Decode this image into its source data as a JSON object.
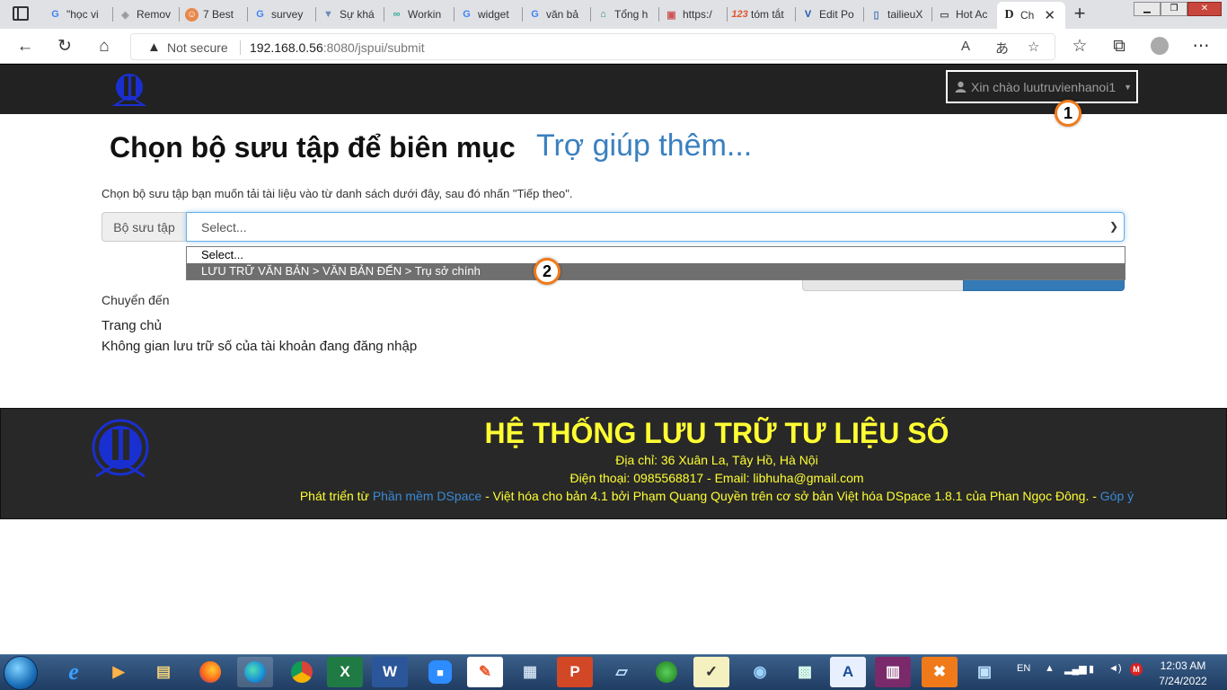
{
  "browser": {
    "tabs": [
      {
        "label": "\"học vi",
        "icon": "google-icon"
      },
      {
        "label": "Remov",
        "icon": "remove-icon"
      },
      {
        "label": "7 Best",
        "icon": "app-icon"
      },
      {
        "label": "survey",
        "icon": "google-icon"
      },
      {
        "label": "Sự khá",
        "icon": "web-icon"
      },
      {
        "label": "Workin",
        "icon": "web-icon"
      },
      {
        "label": "widget",
        "icon": "google-icon"
      },
      {
        "label": "văn bả",
        "icon": "google-icon"
      },
      {
        "label": "Tổng h",
        "icon": "web-icon"
      },
      {
        "label": "https:/",
        "icon": "web-icon"
      },
      {
        "label": "tóm tắt",
        "icon": "123doc-icon"
      },
      {
        "label": "Edit Po",
        "icon": "v-icon"
      },
      {
        "label": "tailieuX",
        "icon": "phone-icon"
      },
      {
        "label": "Hot Ac",
        "icon": "page-icon"
      },
      {
        "label": "Ch",
        "icon": "dspace-icon"
      }
    ],
    "security_label": "Not secure",
    "url_host": "192.168.0.56",
    "url_rest": ":8080/jspui/submit"
  },
  "header": {
    "user_greeting": "Xin chào luutruvienhanoi1"
  },
  "markers": {
    "one": "1",
    "two": "2"
  },
  "main": {
    "title": "Chọn bộ sưu tập để biên mục",
    "help_link": "Trợ giúp thêm...",
    "instruction": "Chọn bộ sưu tập bạn muốn tải tài liệu vào từ danh sách dưới đây, sau đó nhấn \"Tiếp theo\".",
    "collection_label": "Bộ sưu tập",
    "select_value": "Select...",
    "options": [
      "Select...",
      "LƯU TRỮ VĂN BẢN > VĂN BẢN ĐẾN > Trụ sở chính"
    ],
    "jump_label": "Chuyển đến",
    "jump_links": [
      "Trang chủ",
      "Không gian lưu trữ số của tài khoản đang đăng nhập"
    ]
  },
  "footer": {
    "title": "HỆ THỐNG LƯU TRỮ TƯ LIỆU SỐ",
    "address": "Địa chỉ: 36 Xuân La, Tây Hồ, Hà Nội",
    "contact": "Điện thoại: 0985568817 - Email: libhuha@gmail.com",
    "credit_prefix": "Phát triển từ ",
    "credit_link": "Phần mềm DSpace",
    "credit_middle": " - Việt hóa cho bản 4.1 bởi Phạm Quang Quyền trên cơ sở bản Việt hóa DSpace 1.8.1 của Phan Ngọc Đông. - ",
    "feedback_link": "Góp ý"
  },
  "taskbar": {
    "language": "EN",
    "time": "12:03 AM",
    "date": "7/24/2022"
  },
  "colors": {
    "header_bg": "#222222",
    "footer_text": "#ffff33",
    "link_blue": "#3a80c0",
    "marker_border": "#f07a1a"
  }
}
